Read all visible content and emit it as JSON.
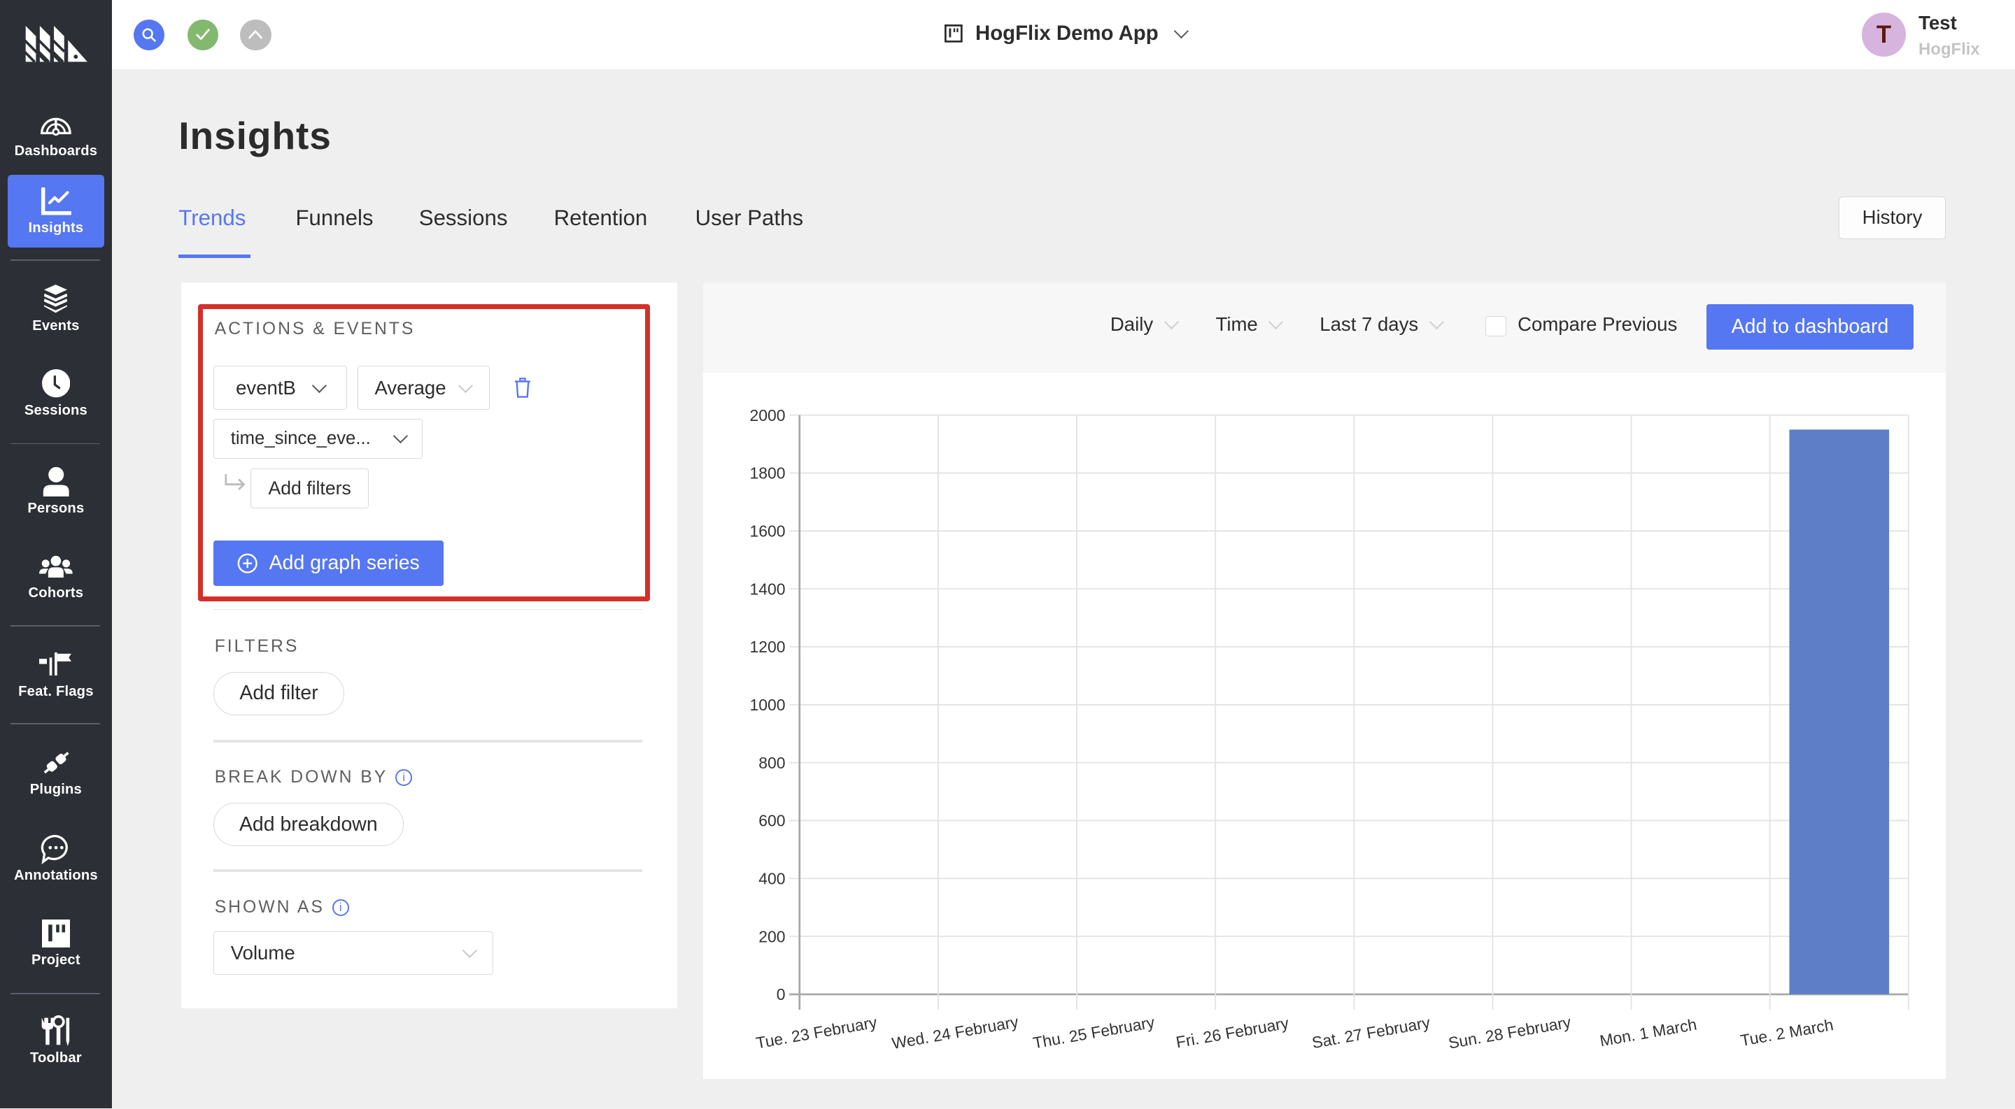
{
  "app": {
    "project_name": "HogFlix Demo App",
    "user": {
      "initial": "T",
      "name": "Test",
      "organization": "HogFlix"
    },
    "colors": {
      "accent": "#5677f2",
      "sidebar": "#2c2f36",
      "highlight_border": "#d3302a",
      "bar": "#5f7ec8"
    }
  },
  "topbar": {
    "status_icons": [
      "search-icon",
      "check-icon",
      "chevron-up-icon"
    ]
  },
  "sidebar": {
    "items": [
      {
        "label": "Dashboards",
        "icon": "dashboard-gauge-icon",
        "active": false
      },
      {
        "label": "Insights",
        "icon": "line-chart-icon",
        "active": true
      },
      {
        "label": "Events",
        "icon": "layers-icon",
        "active": false
      },
      {
        "label": "Sessions",
        "icon": "clock-icon",
        "active": false
      },
      {
        "label": "Persons",
        "icon": "person-icon",
        "active": false
      },
      {
        "label": "Cohorts",
        "icon": "group-icon",
        "active": false
      },
      {
        "label": "Feat. Flags",
        "icon": "flags-icon",
        "active": false
      },
      {
        "label": "Plugins",
        "icon": "plug-icon",
        "active": false
      },
      {
        "label": "Annotations",
        "icon": "chat-bubble-icon",
        "active": false
      },
      {
        "label": "Project",
        "icon": "project-board-icon",
        "active": false
      },
      {
        "label": "Toolbar",
        "icon": "tools-icon",
        "active": false
      }
    ]
  },
  "page": {
    "title": "Insights",
    "tabs": [
      {
        "label": "Trends",
        "active": true
      },
      {
        "label": "Funnels",
        "active": false
      },
      {
        "label": "Sessions",
        "active": false
      },
      {
        "label": "Retention",
        "active": false
      },
      {
        "label": "User Paths",
        "active": false
      }
    ],
    "history_label": "History"
  },
  "panel": {
    "actions_events": {
      "title": "ACTIONS & EVENTS",
      "event": "eventB",
      "math": "Average",
      "property": "time_since_eve...",
      "add_filters_label": "Add filters",
      "add_series_label": "Add graph series"
    },
    "filters": {
      "title": "FILTERS",
      "add_label": "Add filter"
    },
    "breakdown": {
      "title": "BREAK DOWN BY",
      "add_label": "Add breakdown"
    },
    "shown_as": {
      "title": "SHOWN AS",
      "value": "Volume"
    }
  },
  "chart_toolbar": {
    "interval": "Daily",
    "display": "Time",
    "date_range": "Last 7 days",
    "compare_label": "Compare Previous",
    "compare_checked": false,
    "add_to_dashboard_label": "Add to dashboard"
  },
  "chart_data": {
    "type": "bar",
    "title": "",
    "xlabel": "",
    "ylabel": "",
    "categories": [
      "Tue. 23 February",
      "Wed. 24 February",
      "Thu. 25 February",
      "Fri. 26 February",
      "Sat. 27 February",
      "Sun. 28 February",
      "Mon. 1 March",
      "Tue. 2 March"
    ],
    "series": [
      {
        "name": "eventB",
        "values": [
          0,
          0,
          0,
          0,
          0,
          0,
          0,
          1950
        ]
      }
    ],
    "ylim": [
      0,
      2000
    ],
    "yticks": [
      0,
      200,
      400,
      600,
      800,
      1000,
      1200,
      1400,
      1600,
      1800,
      2000
    ],
    "grid": true,
    "legend": "none"
  }
}
